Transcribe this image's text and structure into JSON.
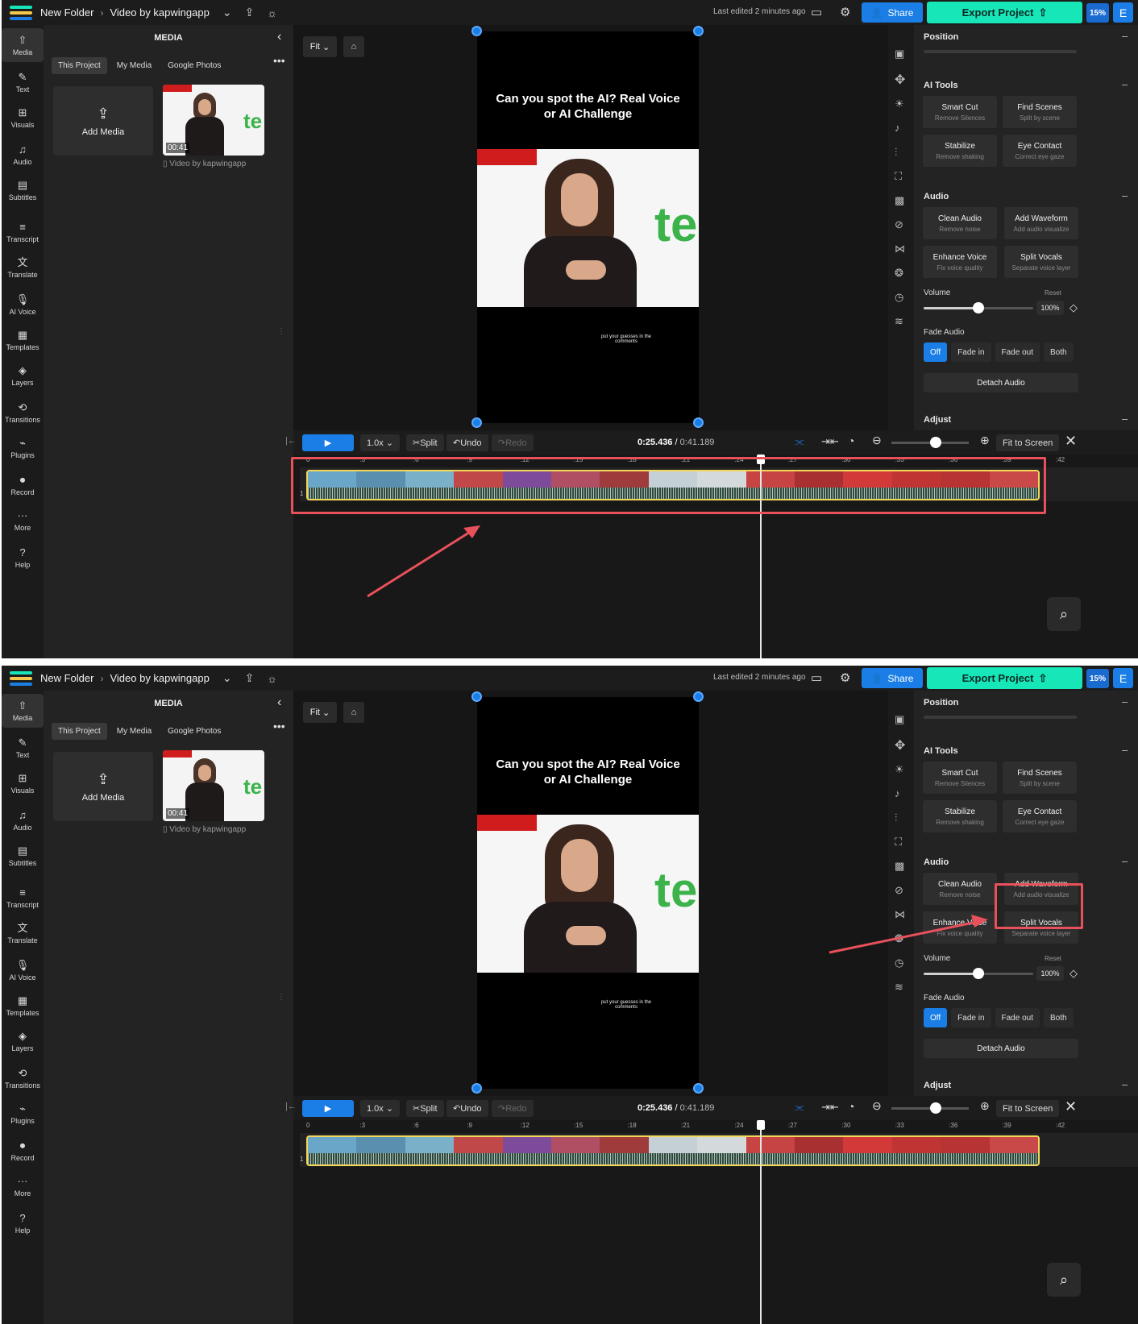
{
  "topbar": {
    "folder": "New Folder",
    "project": "Video by kapwingapp",
    "last_edited": "Last edited 2 minutes ago",
    "share": "Share",
    "export": "Export Project",
    "usage": "15%",
    "avatar": "E"
  },
  "nav": [
    {
      "label": "Media",
      "icon": "media-icon"
    },
    {
      "label": "Text",
      "icon": "text-icon"
    },
    {
      "label": "Visuals",
      "icon": "visuals-icon"
    },
    {
      "label": "Audio",
      "icon": "audio-icon"
    },
    {
      "label": "Subtitles",
      "icon": "subtitles-icon"
    },
    {
      "label": "Transcript",
      "icon": "transcript-icon"
    },
    {
      "label": "Translate",
      "icon": "translate-icon"
    },
    {
      "label": "AI Voice",
      "icon": "ai-voice-icon"
    },
    {
      "label": "Templates",
      "icon": "templates-icon"
    },
    {
      "label": "Layers",
      "icon": "layers-icon"
    },
    {
      "label": "Transitions",
      "icon": "transitions-icon"
    },
    {
      "label": "Plugins",
      "icon": "plugins-icon"
    },
    {
      "label": "Record",
      "icon": "record-icon"
    },
    {
      "label": "More",
      "icon": "more-icon"
    },
    {
      "label": "Help",
      "icon": "help-icon"
    }
  ],
  "media": {
    "title": "MEDIA",
    "tabs": [
      "This Project",
      "My Media",
      "Google Photos"
    ],
    "add_media": "Add Media",
    "clip_duration": "00:41",
    "clip_name": "Video by kapwingapp"
  },
  "canvas": {
    "fit": "Fit",
    "video_title": "Can you spot the AI? Real Voice or AI Challenge",
    "video_caption": "put your guesses in the comments",
    "logo_text": "te"
  },
  "props": {
    "position_title": "Position",
    "ai_tools_title": "AI Tools",
    "ai_tools": [
      {
        "name": "Smart Cut",
        "desc": "Remove Silences"
      },
      {
        "name": "Find Scenes",
        "desc": "Split by scene"
      },
      {
        "name": "Stabilize",
        "desc": "Remove shaking"
      },
      {
        "name": "Eye Contact",
        "desc": "Correct eye gaze"
      }
    ],
    "audio_title": "Audio",
    "audio_tools": [
      {
        "name": "Clean Audio",
        "desc": "Remove noise"
      },
      {
        "name": "Add Waveform",
        "desc": "Add audio visualize"
      },
      {
        "name": "Enhance Voice",
        "desc": "Fix voice quality"
      },
      {
        "name": "Split Vocals",
        "desc": "Separate voice layer"
      }
    ],
    "volume_label": "Volume",
    "reset": "Reset",
    "volume": "100%",
    "volume_level": 0.5,
    "fade_label": "Fade Audio",
    "fade_options": [
      "Off",
      "Fade in",
      "Fade out",
      "Both"
    ],
    "fade_selected": "Off",
    "detach": "Detach Audio",
    "adjust_title": "Adjust"
  },
  "controls": {
    "speed": "1.0x",
    "split": "Split",
    "undo": "Undo",
    "redo": "Redo",
    "current_time": "0:25.436",
    "total_time": "0:41.189",
    "fit_to_screen": "Fit to Screen"
  },
  "timeline": {
    "ruler": [
      "0",
      ":3",
      ":6",
      ":9",
      ":12",
      ":15",
      ":18",
      ":21",
      ":24",
      ":27",
      ":30",
      ":33",
      ":36",
      ":39",
      ":42"
    ],
    "track_number": "1",
    "playhead_seconds": 25.436
  },
  "colors": {
    "accent_blue": "#1a7ee6",
    "export_green": "#17e6b8",
    "highlight_red": "#e8505b"
  }
}
